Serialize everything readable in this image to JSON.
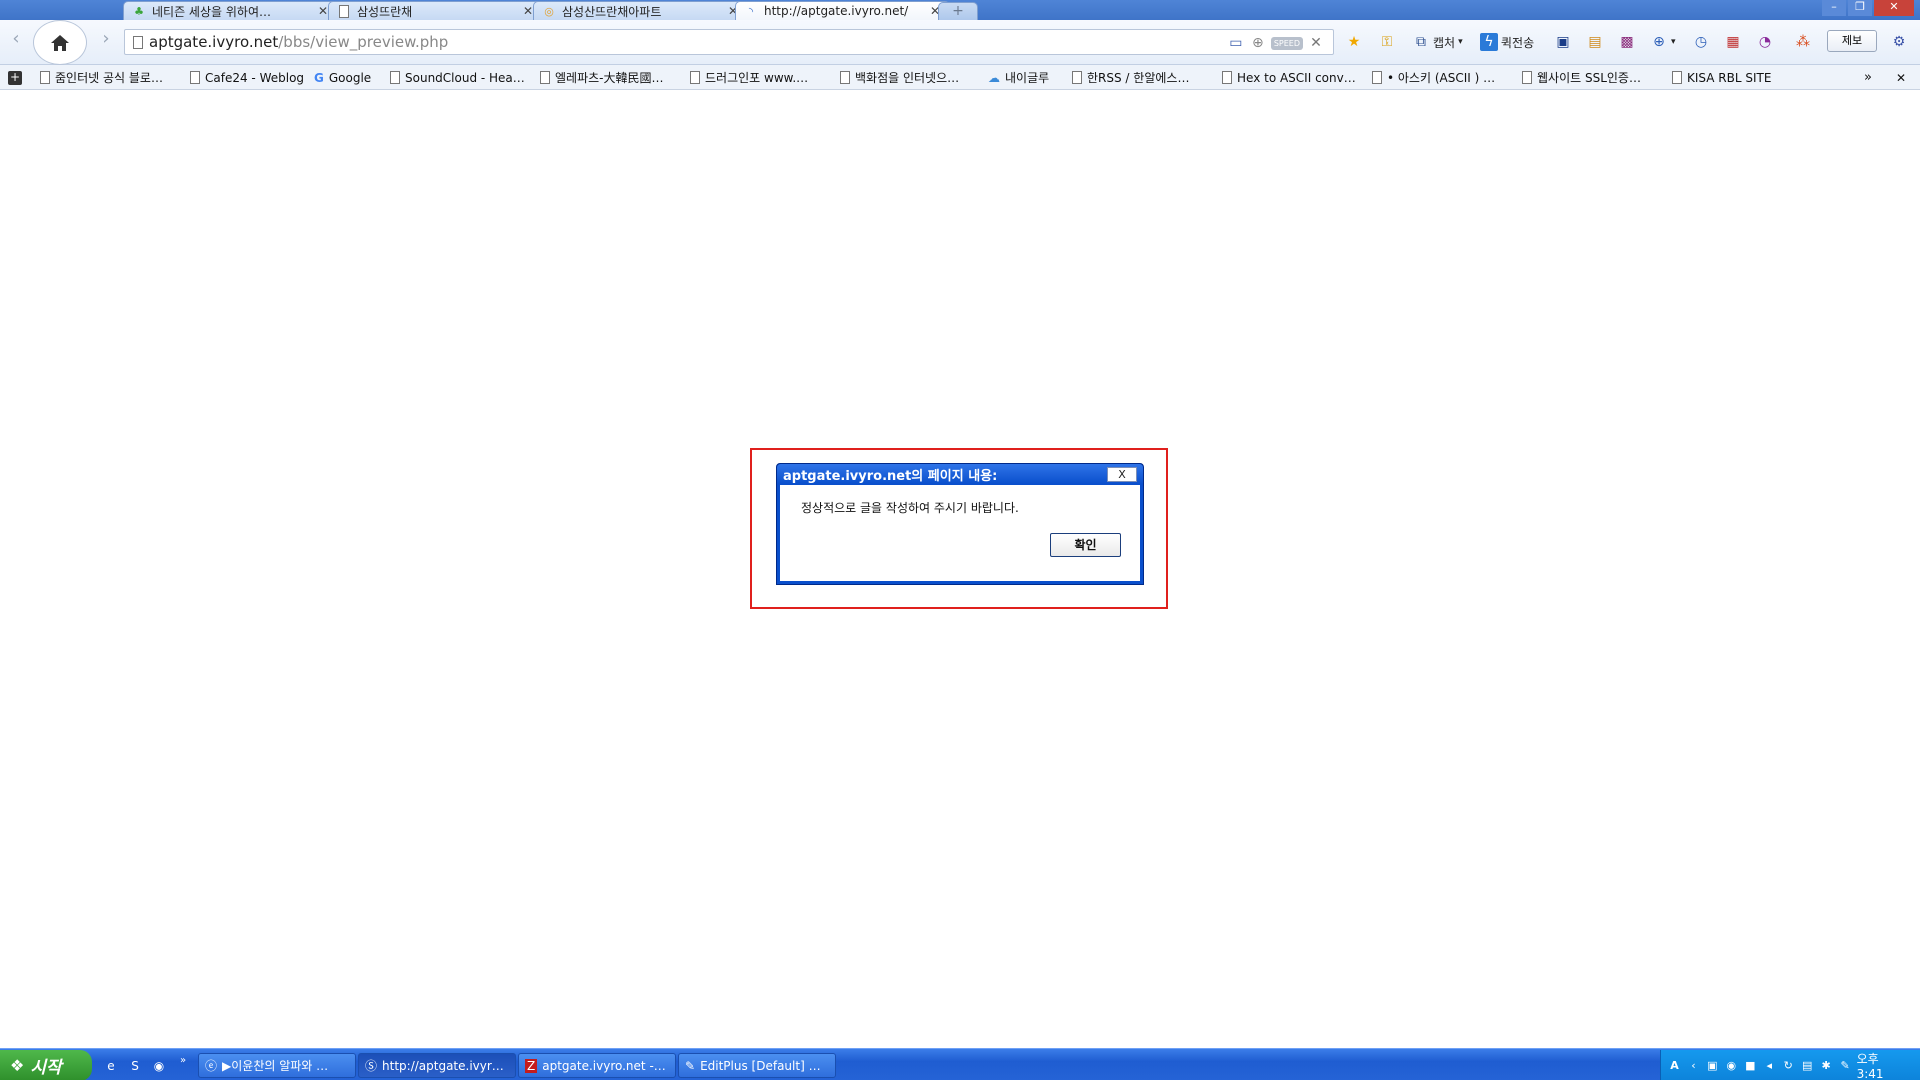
{
  "tabs": [
    {
      "title": "네티즌 세상을 위하여…",
      "icon": "sprout-icon"
    },
    {
      "title": "삼성뜨란채",
      "icon": "page-icon"
    },
    {
      "title": "삼성산뜨란채아파트",
      "icon": "globe-icon"
    },
    {
      "title": "http://aptgate.ivyro.net/",
      "icon": "loading-icon"
    }
  ],
  "new_tab_label": "+",
  "window_controls": {
    "minimize": "–",
    "maximize": "❐",
    "close": "✕"
  },
  "address": {
    "domain": "aptgate.ivyro.net",
    "path": "/bbs/view_preview.php"
  },
  "address_speed_badge": "SPEED",
  "toolbar": {
    "capture_label": "캡처",
    "quick_send_label": "퀵전송",
    "report_label": "제보"
  },
  "bookmarks": [
    "줌인터넷 공식 블로…",
    "Cafe24 - Weblog",
    "Google",
    "SoundCloud - Hea…",
    "엘레파츠-大韓民國…",
    "드러그인포 www.…",
    "백화점을 인터넷으…",
    "내이글루",
    "한RSS / 한알에스…",
    "Hex to ASCII conv…",
    "• 아스키 (ASCII ) …",
    "웹사이트 SSL인증…",
    "KISA RBL SITE"
  ],
  "bookmarks_overflow": "»",
  "dialog": {
    "title": "aptgate.ivyro.net의 페이지 내용:",
    "close": "X",
    "message": "정상적으로 글을 작성하여 주시기 바랍니다.",
    "ok_label": "확인"
  },
  "taskbar": {
    "start_label": "시작",
    "tasks": [
      {
        "label": "▶이윤찬의 알파와 …",
        "icon": "ie-icon"
      },
      {
        "label": "http://aptgate.ivyr…",
        "icon": "swing-icon"
      },
      {
        "label": "aptgate.ivyro.net -…",
        "icon": "filezilla-icon"
      },
      {
        "label": "EditPlus [Default] …",
        "icon": "editplus-icon"
      }
    ],
    "clock": "오후 3:41"
  },
  "colors": {
    "dialog_title": "#0a4fcc",
    "highlight_border": "#e0201d",
    "taskbar": "#2563d6",
    "start_button": "#3a9f36"
  }
}
